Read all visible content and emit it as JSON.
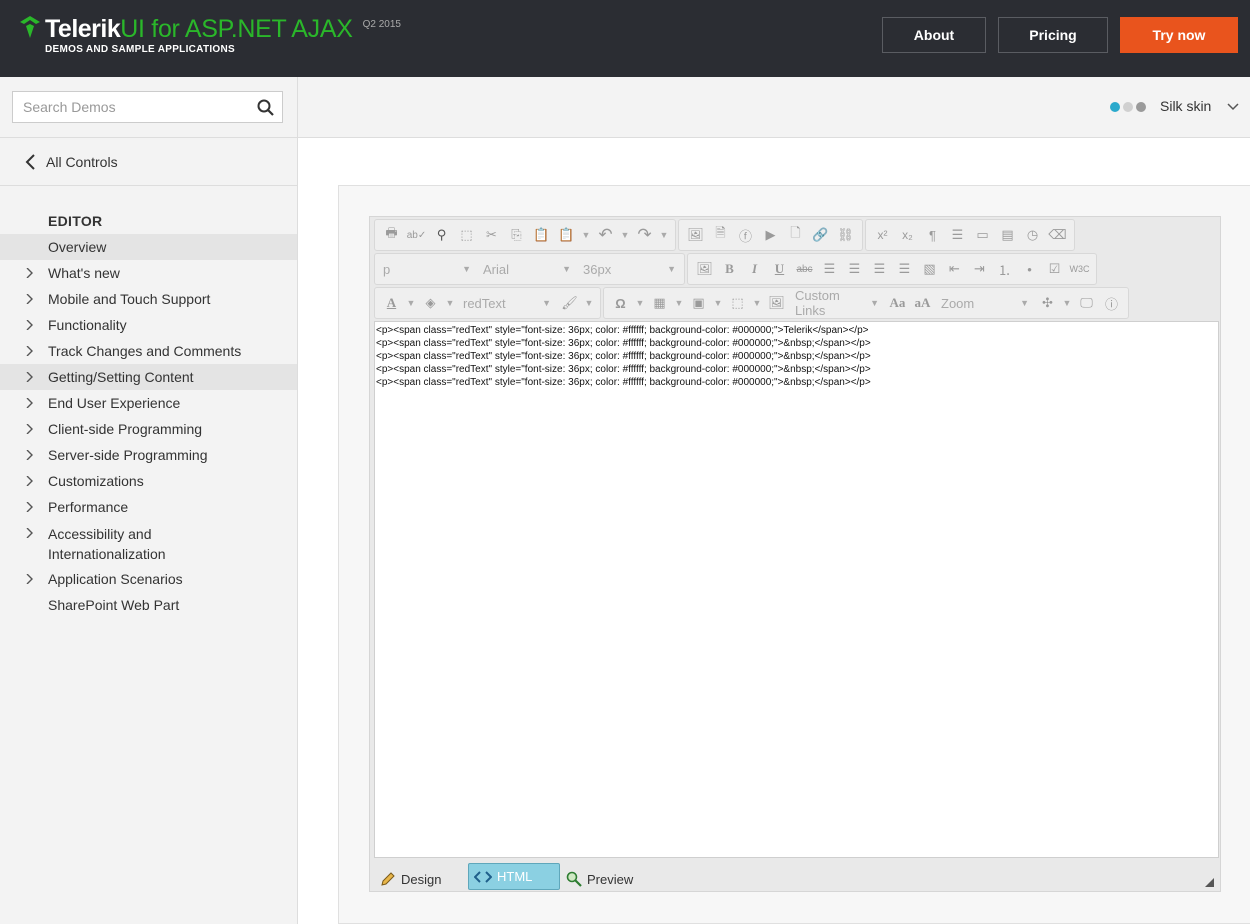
{
  "header": {
    "brand": "Telerik",
    "product": "UI for ASP.NET AJAX",
    "version": "Q2 2015",
    "subtitle": "DEMOS AND SAMPLE APPLICATIONS",
    "about": "About",
    "pricing": "Pricing",
    "try_now": "Try now",
    "accent": "#2ab72a",
    "cta_color": "#e9541d"
  },
  "sidebar": {
    "search_placeholder": "Search Demos",
    "back_label": "All Controls",
    "section": "EDITOR",
    "items": [
      {
        "label": "Overview"
      },
      {
        "label": "What's new"
      },
      {
        "label": "Mobile and Touch Support"
      },
      {
        "label": "Functionality"
      },
      {
        "label": "Track Changes and Comments"
      },
      {
        "label": "Getting/Setting Content"
      },
      {
        "label": "End User Experience"
      },
      {
        "label": "Client-side Programming"
      },
      {
        "label": "Server-side Programming"
      },
      {
        "label": "Customizations"
      },
      {
        "label": "Performance"
      },
      {
        "label": "Accessibility and Internationalization"
      },
      {
        "label": "Application Scenarios"
      },
      {
        "label": "SharePoint Web Part"
      }
    ]
  },
  "skin": {
    "label": "Silk skin",
    "dot_colors": [
      "#2aa9cc",
      "#d0d0d0",
      "#9a9a9a"
    ]
  },
  "editor": {
    "format_block": "p",
    "font_name": "Arial",
    "font_size": "36px",
    "css_class": "redText",
    "custom_links": "Custom Links",
    "zoom": "Zoom",
    "html_lines": [
      "<p><span class=\"redText\" style=\"font-size: 36px; color: #ffffff; background-color: #000000;\">Telerik</span></p>",
      "<p><span class=\"redText\" style=\"font-size: 36px; color: #ffffff; background-color: #000000;\">&nbsp;</span></p>",
      "<p><span class=\"redText\" style=\"font-size: 36px; color: #ffffff; background-color: #000000;\">&nbsp;</span></p>",
      "<p><span class=\"redText\" style=\"font-size: 36px; color: #ffffff; background-color: #000000;\">&nbsp;</span></p>",
      "<p><span class=\"redText\" style=\"font-size: 36px; color: #ffffff; background-color: #000000;\">&nbsp;</span></p>"
    ],
    "modes": {
      "design": "Design",
      "html": "HTML",
      "preview": "Preview"
    },
    "active_mode": "HTML"
  }
}
